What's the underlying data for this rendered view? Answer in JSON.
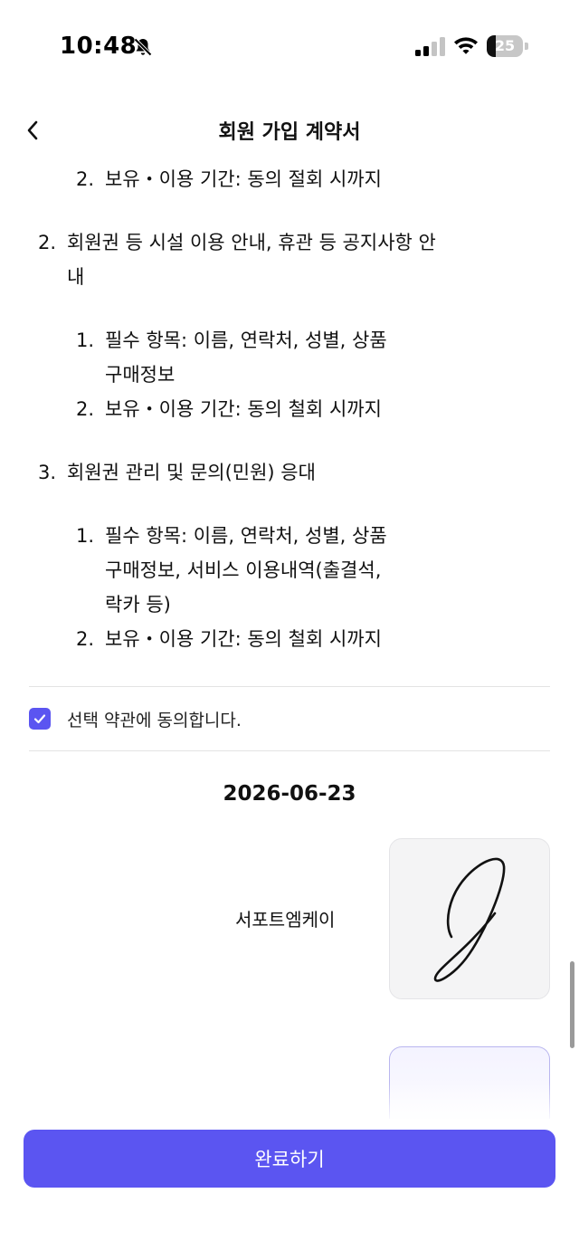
{
  "status_bar": {
    "time": "10:48",
    "battery": "25",
    "battery_level": 0.25
  },
  "header": {
    "title": "회원 가입 계약서"
  },
  "terms": {
    "item1_sub2": {
      "number": "2.",
      "text": "보유・이용 기간: 동의 절회 시까지"
    },
    "item2": {
      "number": "2.",
      "line1": "회원권 등 시설 이용 안내, 휴관 등 공지사항 안",
      "line2": "내",
      "sub1": {
        "number": "1.",
        "line1": "필수 항목: 이름, 연락처, 성별, 상품",
        "line2": "구매정보"
      },
      "sub2": {
        "number": "2.",
        "text": "보유・이용 기간: 동의 철회 시까지"
      }
    },
    "item3": {
      "number": "3.",
      "line1": "회원권 관리 및 문의(민원) 응대",
      "sub1": {
        "number": "1.",
        "line1": "필수 항목: 이름, 연락처, 성별, 상품",
        "line2": "구매정보, 서비스 이용내역(출결석,",
        "line3": "락카 등)"
      },
      "sub2": {
        "number": "2.",
        "text": "보유・이용 기간: 동의 철회 시까지"
      }
    }
  },
  "agreement": {
    "label": "선택 약관에 동의합니다.",
    "checked": true
  },
  "contract_date": "2026-06-23",
  "signer": {
    "name": "서포트엠케이"
  },
  "footer": {
    "complete_label": "완료하기"
  },
  "colors": {
    "accent": "#5b55f1"
  }
}
